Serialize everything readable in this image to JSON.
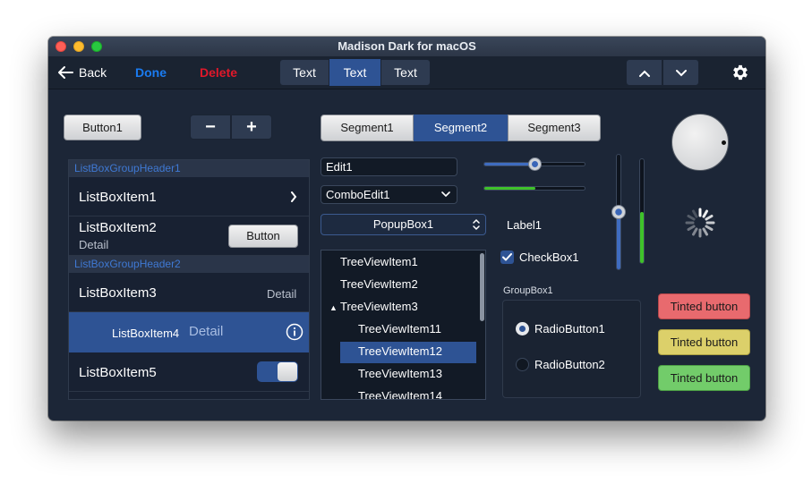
{
  "window": {
    "title": "Madison Dark for macOS"
  },
  "toolbar": {
    "back_label": "Back",
    "done_label": "Done",
    "delete_label": "Delete",
    "segments": [
      "Text",
      "Text",
      "Text"
    ]
  },
  "controls": {
    "button1_label": "Button1",
    "stepper_minus": "−",
    "stepper_plus": "+",
    "segments": [
      "Segment1",
      "Segment2",
      "Segment3"
    ],
    "edit1_value": "Edit1",
    "combo_value": "ComboEdit1",
    "popup_value": "PopupBox1",
    "label1": "Label1",
    "checkbox_label": "CheckBox1",
    "groupbox_title": "GroupBox1",
    "radio1_label": "RadioButton1",
    "radio2_label": "RadioButton2",
    "tinted": [
      "Tinted button",
      "Tinted button",
      "Tinted button"
    ],
    "slider_h_value": 0.5,
    "progress_h_value": 0.5,
    "slider_v_value": 0.5,
    "progress_v_value": 0.5
  },
  "listbox": {
    "header1": "ListBoxGroupHeader1",
    "header2": "ListBoxGroupHeader2",
    "item1": "ListBoxItem1",
    "item2": "ListBoxItem2",
    "item2_detail": "Detail",
    "item2_button": "Button",
    "item3": "ListBoxItem3",
    "item3_detail": "Detail",
    "item4": "ListBoxItem4",
    "item4_detail": "Detail",
    "item5": "ListBoxItem5"
  },
  "tree": {
    "items": [
      "TreeViewItem1",
      "TreeViewItem2",
      "TreeViewItem3",
      "TreeViewItem11",
      "TreeViewItem12",
      "TreeViewItem13",
      "TreeViewItem14"
    ]
  },
  "colors": {
    "accent": "#2e5394",
    "delete": "#e0182a",
    "done": "#1a7bf0",
    "tint_red": "#e86a6e",
    "tint_yellow": "#dcd06a",
    "tint_green": "#72cc6a"
  }
}
